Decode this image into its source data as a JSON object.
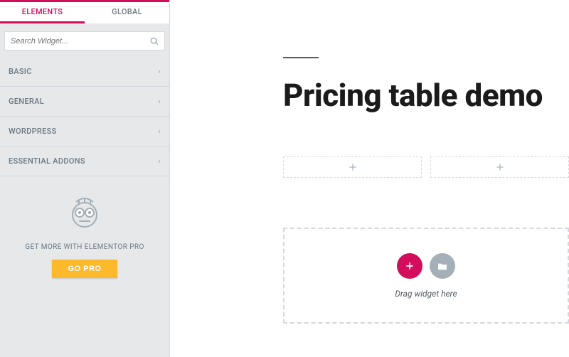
{
  "tabs": {
    "elements": "ELEMENTS",
    "global": "GLOBAL"
  },
  "search": {
    "placeholder": "Search Widget..."
  },
  "categories": [
    {
      "label": "BASIC"
    },
    {
      "label": "GENERAL"
    },
    {
      "label": "WORDPRESS"
    },
    {
      "label": "ESSENTIAL ADDONS"
    }
  ],
  "promo": {
    "text": "GET MORE WITH ELEMENTOR PRO",
    "button": "GO PRO"
  },
  "page": {
    "title": "Pricing table demo",
    "dropzone_hint": "Drag widget here"
  },
  "icons": {
    "plus": "+",
    "chevron_right": "›",
    "chevron_left": "‹"
  }
}
